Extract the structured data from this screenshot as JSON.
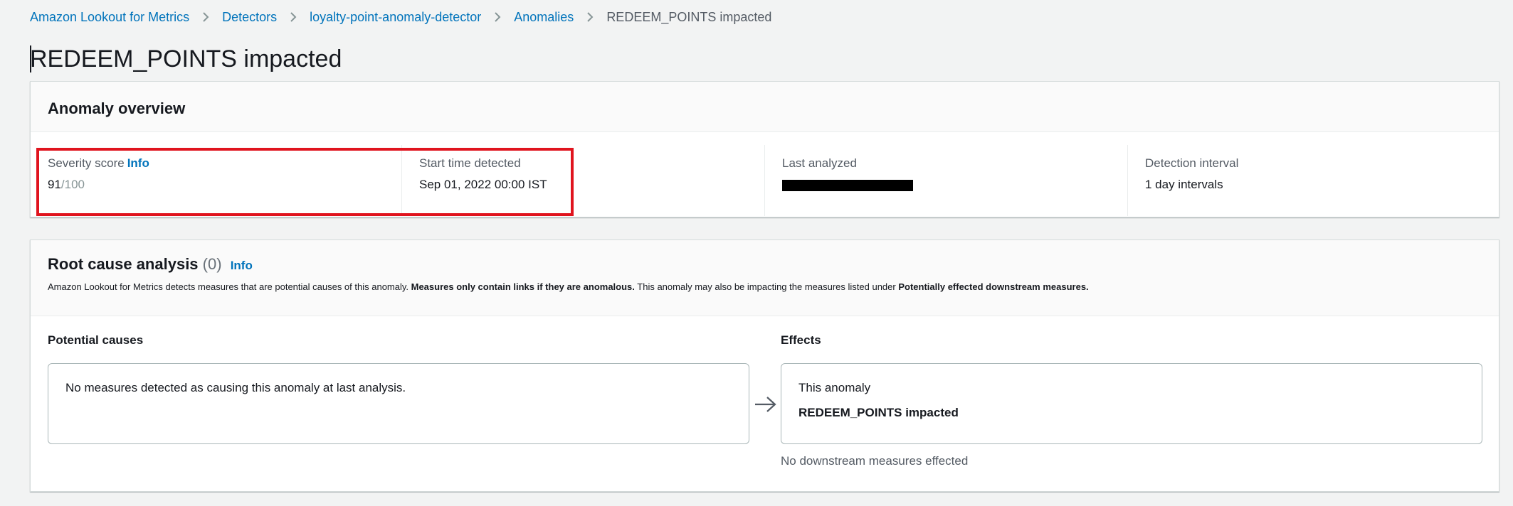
{
  "breadcrumb": [
    {
      "label": "Amazon Lookout for Metrics",
      "link": true
    },
    {
      "label": "Detectors",
      "link": true
    },
    {
      "label": "loyalty-point-anomaly-detector",
      "link": true
    },
    {
      "label": "Anomalies",
      "link": true
    },
    {
      "label": "REDEEM_POINTS impacted",
      "link": false
    }
  ],
  "page_title": "REDEEM_POINTS impacted",
  "overview": {
    "title": "Anomaly overview",
    "severity": {
      "label": "Severity score",
      "info": "Info",
      "value": "91",
      "max": "/100"
    },
    "start_time": {
      "label": "Start time detected",
      "value": "Sep 01, 2022 00:00 IST"
    },
    "last_analyzed": {
      "label": "Last analyzed",
      "value": "[redacted]"
    },
    "detection_interval": {
      "label": "Detection interval",
      "value": "1 day intervals"
    }
  },
  "root_cause": {
    "title": "Root cause analysis",
    "count": "(0)",
    "info": "Info",
    "desc_part1": "Amazon Lookout for Metrics detects measures that are potential causes of this anomaly. ",
    "desc_bold1": "Measures only contain links if they are anomalous.",
    "desc_part2": " This anomaly may also be impacting the measures listed under ",
    "desc_bold2": "Potentially effected downstream measures.",
    "potential_causes_title": "Potential causes",
    "potential_causes_empty": "No measures detected as causing this anomaly at last analysis.",
    "effects_title": "Effects",
    "effects_label": "This anomaly",
    "effects_value": "REDEEM_POINTS impacted",
    "downstream_note": "No downstream measures effected"
  },
  "colors": {
    "link": "#0073bb",
    "highlight": "#e0141e",
    "background": "#f2f3f3"
  }
}
